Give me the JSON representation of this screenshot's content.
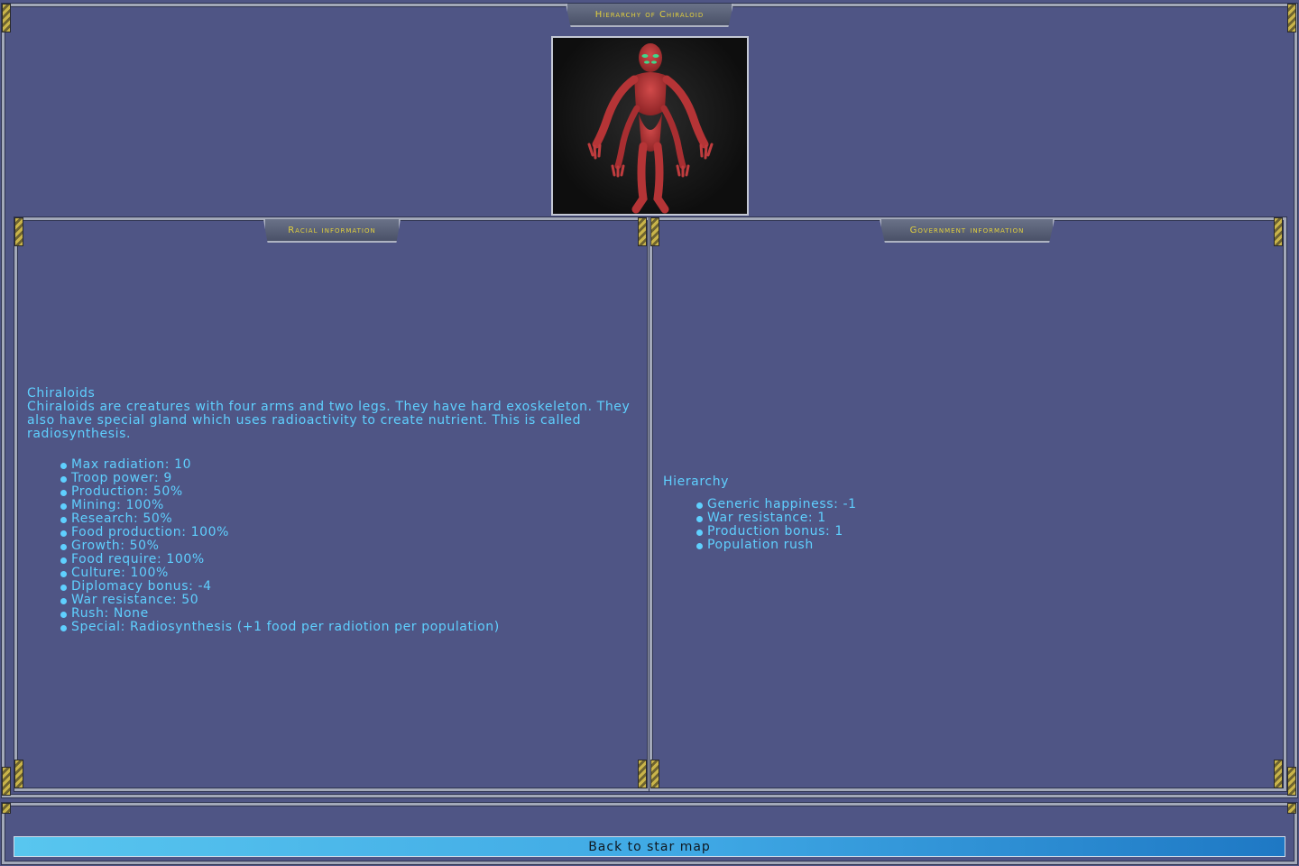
{
  "window": {
    "title": "Hierarchy of Chiraloid"
  },
  "racial": {
    "panel_title": "Racial information",
    "race_name": "Chiraloids",
    "description": "Chiraloids are creatures with four arms and two legs. They have hard exoskeleton. They also have special gland which uses radioactivity to create nutrient. This is called radiosynthesis.",
    "stats": [
      "Max radiation: 10",
      "Troop power: 9",
      "Production: 50%",
      "Mining: 100%",
      "Research: 50%",
      "Food production: 100%",
      "Growth: 50%",
      "Food require: 100%",
      "Culture: 100%",
      "Diplomacy bonus: -4",
      "War resistance: 50",
      "Rush: None",
      "Special: Radiosynthesis (+1 food per radiotion per population)"
    ]
  },
  "government": {
    "panel_title": "Government information",
    "name": "Hierarchy",
    "stats": [
      "Generic happiness: -1",
      "War resistance: 1",
      "Production bonus: 1",
      "Population rush"
    ]
  },
  "footer": {
    "back_button": "Back to star map"
  },
  "colors": {
    "background": "#4f5585",
    "text": "#5fd0ff",
    "title": "#e1cf3d",
    "button": "#3ea7e4"
  }
}
